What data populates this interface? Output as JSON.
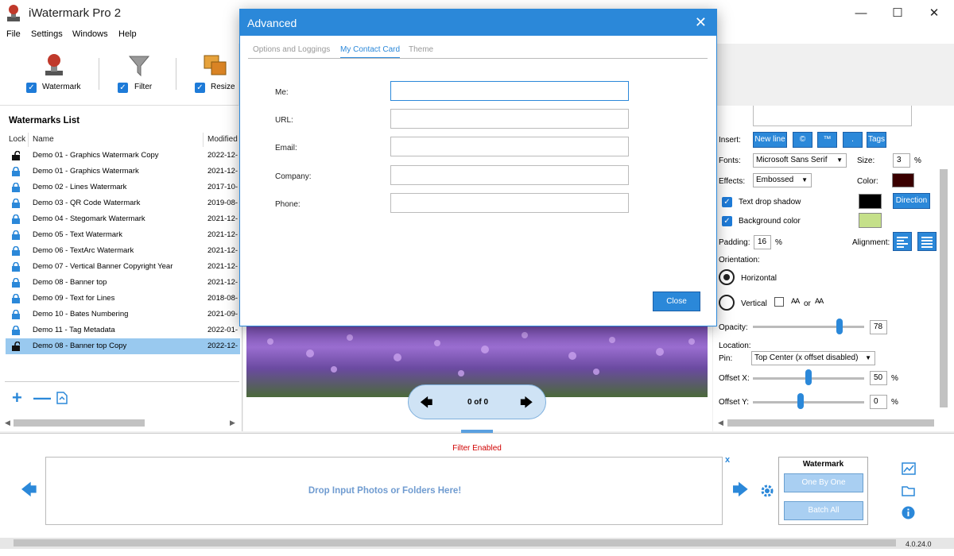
{
  "app": {
    "title": "iWatermark Pro 2",
    "version": "4.0.24.0"
  },
  "menu": [
    "File",
    "Settings",
    "Windows",
    "Help"
  ],
  "toolbar": {
    "watermark_label": "Watermark",
    "filter_label": "Filter",
    "resize_label": "Resize"
  },
  "watermarks": {
    "heading": "Watermarks List",
    "columns": [
      "Lock",
      "Name",
      "Modified"
    ],
    "rows": [
      {
        "name": "Demo 01 - Graphics Watermark Copy",
        "modified": "2022-12-",
        "locked": false
      },
      {
        "name": "Demo 01 - Graphics Watermark",
        "modified": "2021-12-",
        "locked": true
      },
      {
        "name": "Demo 02 - Lines Watermark",
        "modified": "2017-10-",
        "locked": true
      },
      {
        "name": "Demo 03 - QR Code Watermark",
        "modified": "2019-08-",
        "locked": true
      },
      {
        "name": "Demo 04 - Stegomark Watermark",
        "modified": "2021-12-",
        "locked": true
      },
      {
        "name": "Demo 05 - Text Watermark",
        "modified": "2021-12-",
        "locked": true
      },
      {
        "name": "Demo 06 - TextArc Watermark",
        "modified": "2021-12-",
        "locked": true
      },
      {
        "name": "Demo 07 - Vertical Banner Copyright Year",
        "modified": "2021-12-",
        "locked": true
      },
      {
        "name": "Demo 08 - Banner top",
        "modified": "2021-12-",
        "locked": true
      },
      {
        "name": "Demo 09 - Text for Lines",
        "modified": "2018-08-",
        "locked": true
      },
      {
        "name": "Demo 10 - Bates Numbering",
        "modified": "2021-09-",
        "locked": true
      },
      {
        "name": "Demo 11 - Tag Metadata",
        "modified": "2022-01-",
        "locked": true
      },
      {
        "name": "Demo 08 - Banner top Copy",
        "modified": "2022-12-",
        "locked": false,
        "selected": true
      }
    ]
  },
  "preview": {
    "counter": "0 of 0"
  },
  "right": {
    "insert_label": "Insert:",
    "insert_buttons": [
      "New line",
      "©",
      "™",
      ".",
      "Tags"
    ],
    "fonts_label": "Fonts:",
    "font_value": "Microsoft Sans Serif",
    "size_label": "Size:",
    "size_value": "3",
    "percent": "%",
    "effects_label": "Effects:",
    "effects_value": "Embossed",
    "color_label": "Color:",
    "color_value": "#3a0000",
    "shadow_label": "Text drop shadow",
    "shadow_color": "#000000",
    "direction_label": "Direction",
    "bg_label": "Background color",
    "bg_color": "#c5e08a",
    "padding_label": "Padding:",
    "padding_value": "16",
    "alignment_label": "Alignment:",
    "orientation_label": "Orientation:",
    "horizontal_label": "Horizontal",
    "vertical_label": "Vertical",
    "or_label": "or",
    "opacity_label": "Opacity:",
    "opacity_value": "78",
    "location_label": "Location:",
    "pin_label": "Pin:",
    "pin_value": "Top Center (x offset disabled)",
    "offsetx_label": "Offset X:",
    "offsetx_value": "50",
    "offsety_label": "Offset Y:",
    "offsety_value": "0"
  },
  "bottom": {
    "filter_status": "Filter Enabled",
    "drop_text": "Drop Input Photos or Folders Here!",
    "x_label": "x",
    "wm_title": "Watermark",
    "one_by_one": "One By One",
    "batch_all": "Batch All"
  },
  "dialog": {
    "title": "Advanced",
    "tabs": [
      "Options and Loggings",
      "My Contact Card",
      "Theme"
    ],
    "fields": [
      {
        "label": "Me:",
        "value": ""
      },
      {
        "label": "URL:",
        "value": ""
      },
      {
        "label": "Email:",
        "value": ""
      },
      {
        "label": "Company:",
        "value": ""
      },
      {
        "label": "Phone:",
        "value": ""
      }
    ],
    "close_label": "Close"
  }
}
